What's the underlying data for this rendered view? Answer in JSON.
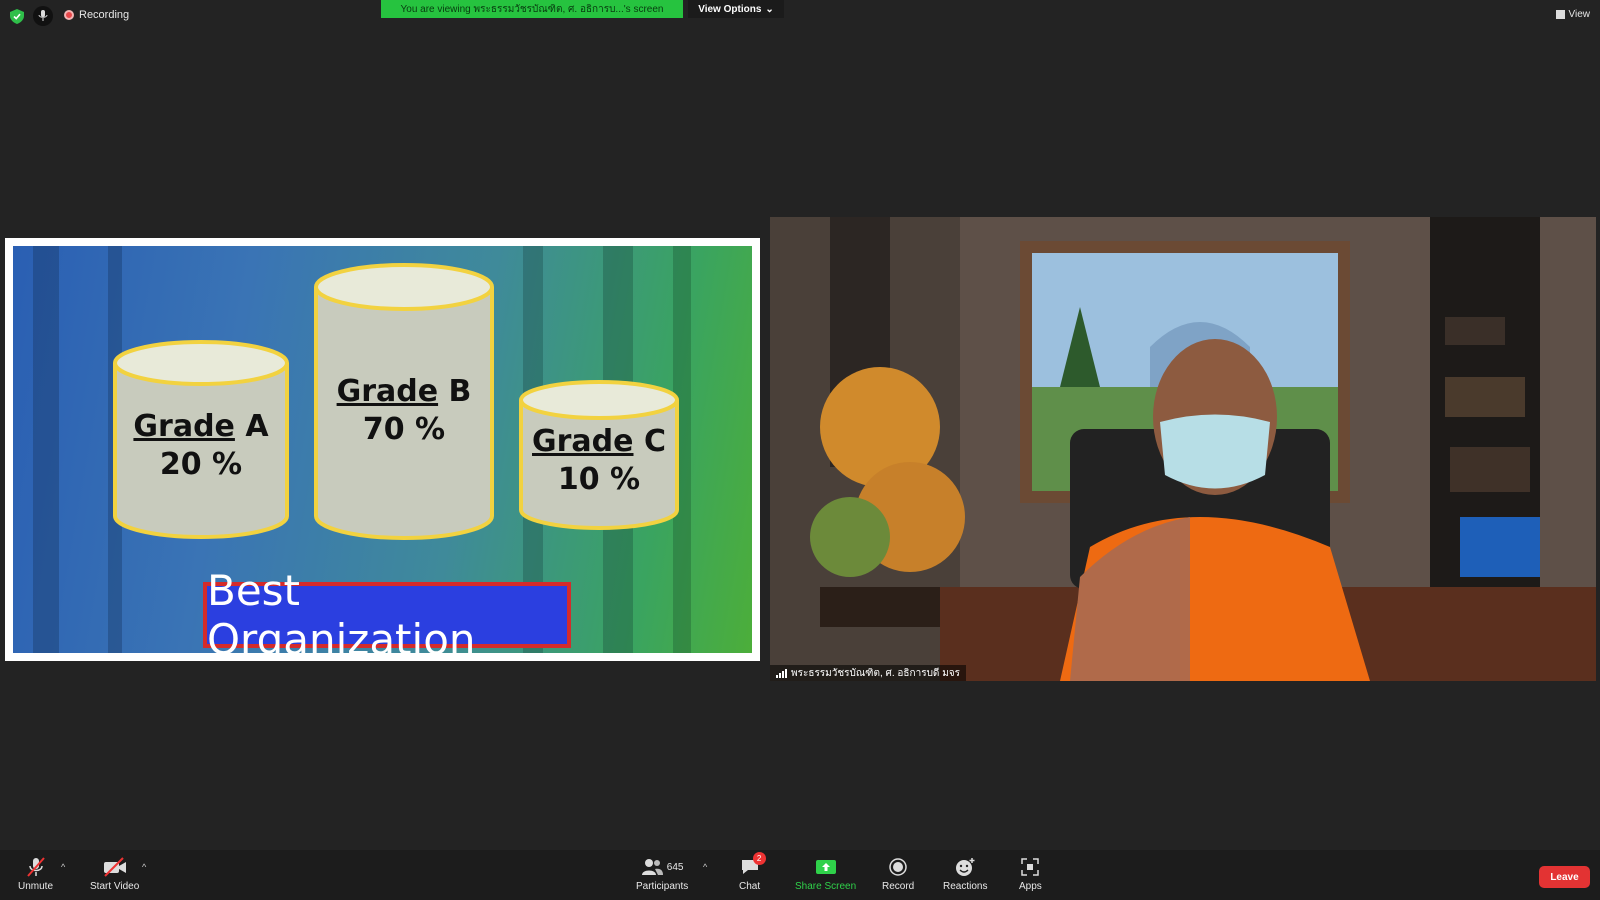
{
  "top_bar": {
    "recording_label": "Recording",
    "viewing_banner": "You are viewing พระธรรมวัชรบัณฑิต, ศ. อธิการบ...'s screen",
    "view_options_label": "View Options",
    "view_label": "View"
  },
  "shared_screen": {
    "cylinders": [
      {
        "grade": "Grade",
        "letter": "A",
        "percent": "20 %"
      },
      {
        "grade": "Grade",
        "letter": "B",
        "percent": "70 %"
      },
      {
        "grade": "Grade",
        "letter": "C",
        "percent": "10 %"
      }
    ],
    "banner_text": "Best Organization"
  },
  "video": {
    "participant_name": "พระธรรมวัชรบัณฑิต, ศ. อธิการบดี มจร"
  },
  "toolbar": {
    "unmute": "Unmute",
    "start_video": "Start Video",
    "participants": "Participants",
    "participant_count": "645",
    "chat": "Chat",
    "chat_badge": "2",
    "share_screen": "Share Screen",
    "record": "Record",
    "reactions": "Reactions",
    "apps": "Apps",
    "leave": "Leave"
  },
  "colors": {
    "banner_green": "#26c33f",
    "share_green": "#2fd14a",
    "leave_red": "#e33333"
  }
}
